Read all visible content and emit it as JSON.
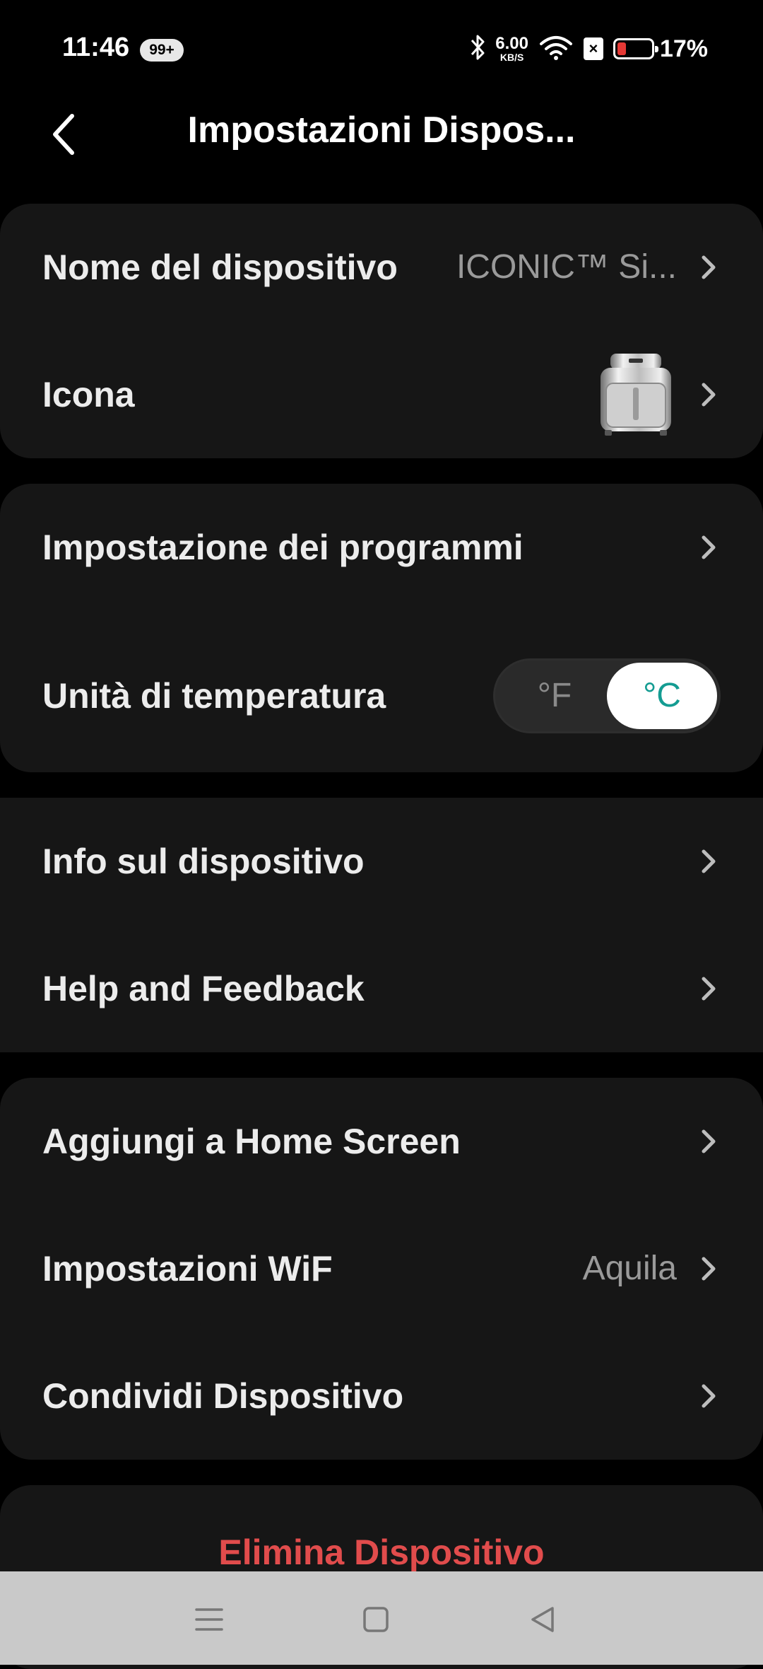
{
  "status_bar": {
    "time": "11:46",
    "notification_badge": "99+",
    "net_speed_value": "6.00",
    "net_speed_unit": "KB/S",
    "battery_percent": "17%",
    "battery_level": 0.17,
    "icons": [
      "bluetooth-icon",
      "wifi-icon",
      "sim-off-icon",
      "battery-icon"
    ]
  },
  "header": {
    "title": "Impostazioni Dispos..."
  },
  "groups": {
    "device": {
      "name_label": "Nome del dispositivo",
      "name_value": "ICONIC™ Si...",
      "icon_label": "Icona"
    },
    "program": {
      "programs_label": "Impostazione dei programmi",
      "temp_label": "Unità di temperatura",
      "temp_options": [
        "°F",
        "°C"
      ],
      "temp_selected": "°C"
    },
    "info": {
      "device_info_label": "Info sul dispositivo",
      "help_label": "Help and Feedback"
    },
    "more": {
      "home_screen_label": "Aggiungi a Home Screen",
      "wifi_label": "Impostazioni WiF",
      "wifi_value": "Aquila",
      "share_label": "Condividi Dispositivo"
    },
    "danger": {
      "delete_label": "Elimina Dispositivo"
    }
  },
  "colors": {
    "background": "#000000",
    "card": "#161616",
    "accent": "#149c92",
    "danger": "#e14c4c"
  },
  "nav_bar": {
    "icons": [
      "menu-icon",
      "home-icon",
      "back-triangle-icon"
    ]
  }
}
